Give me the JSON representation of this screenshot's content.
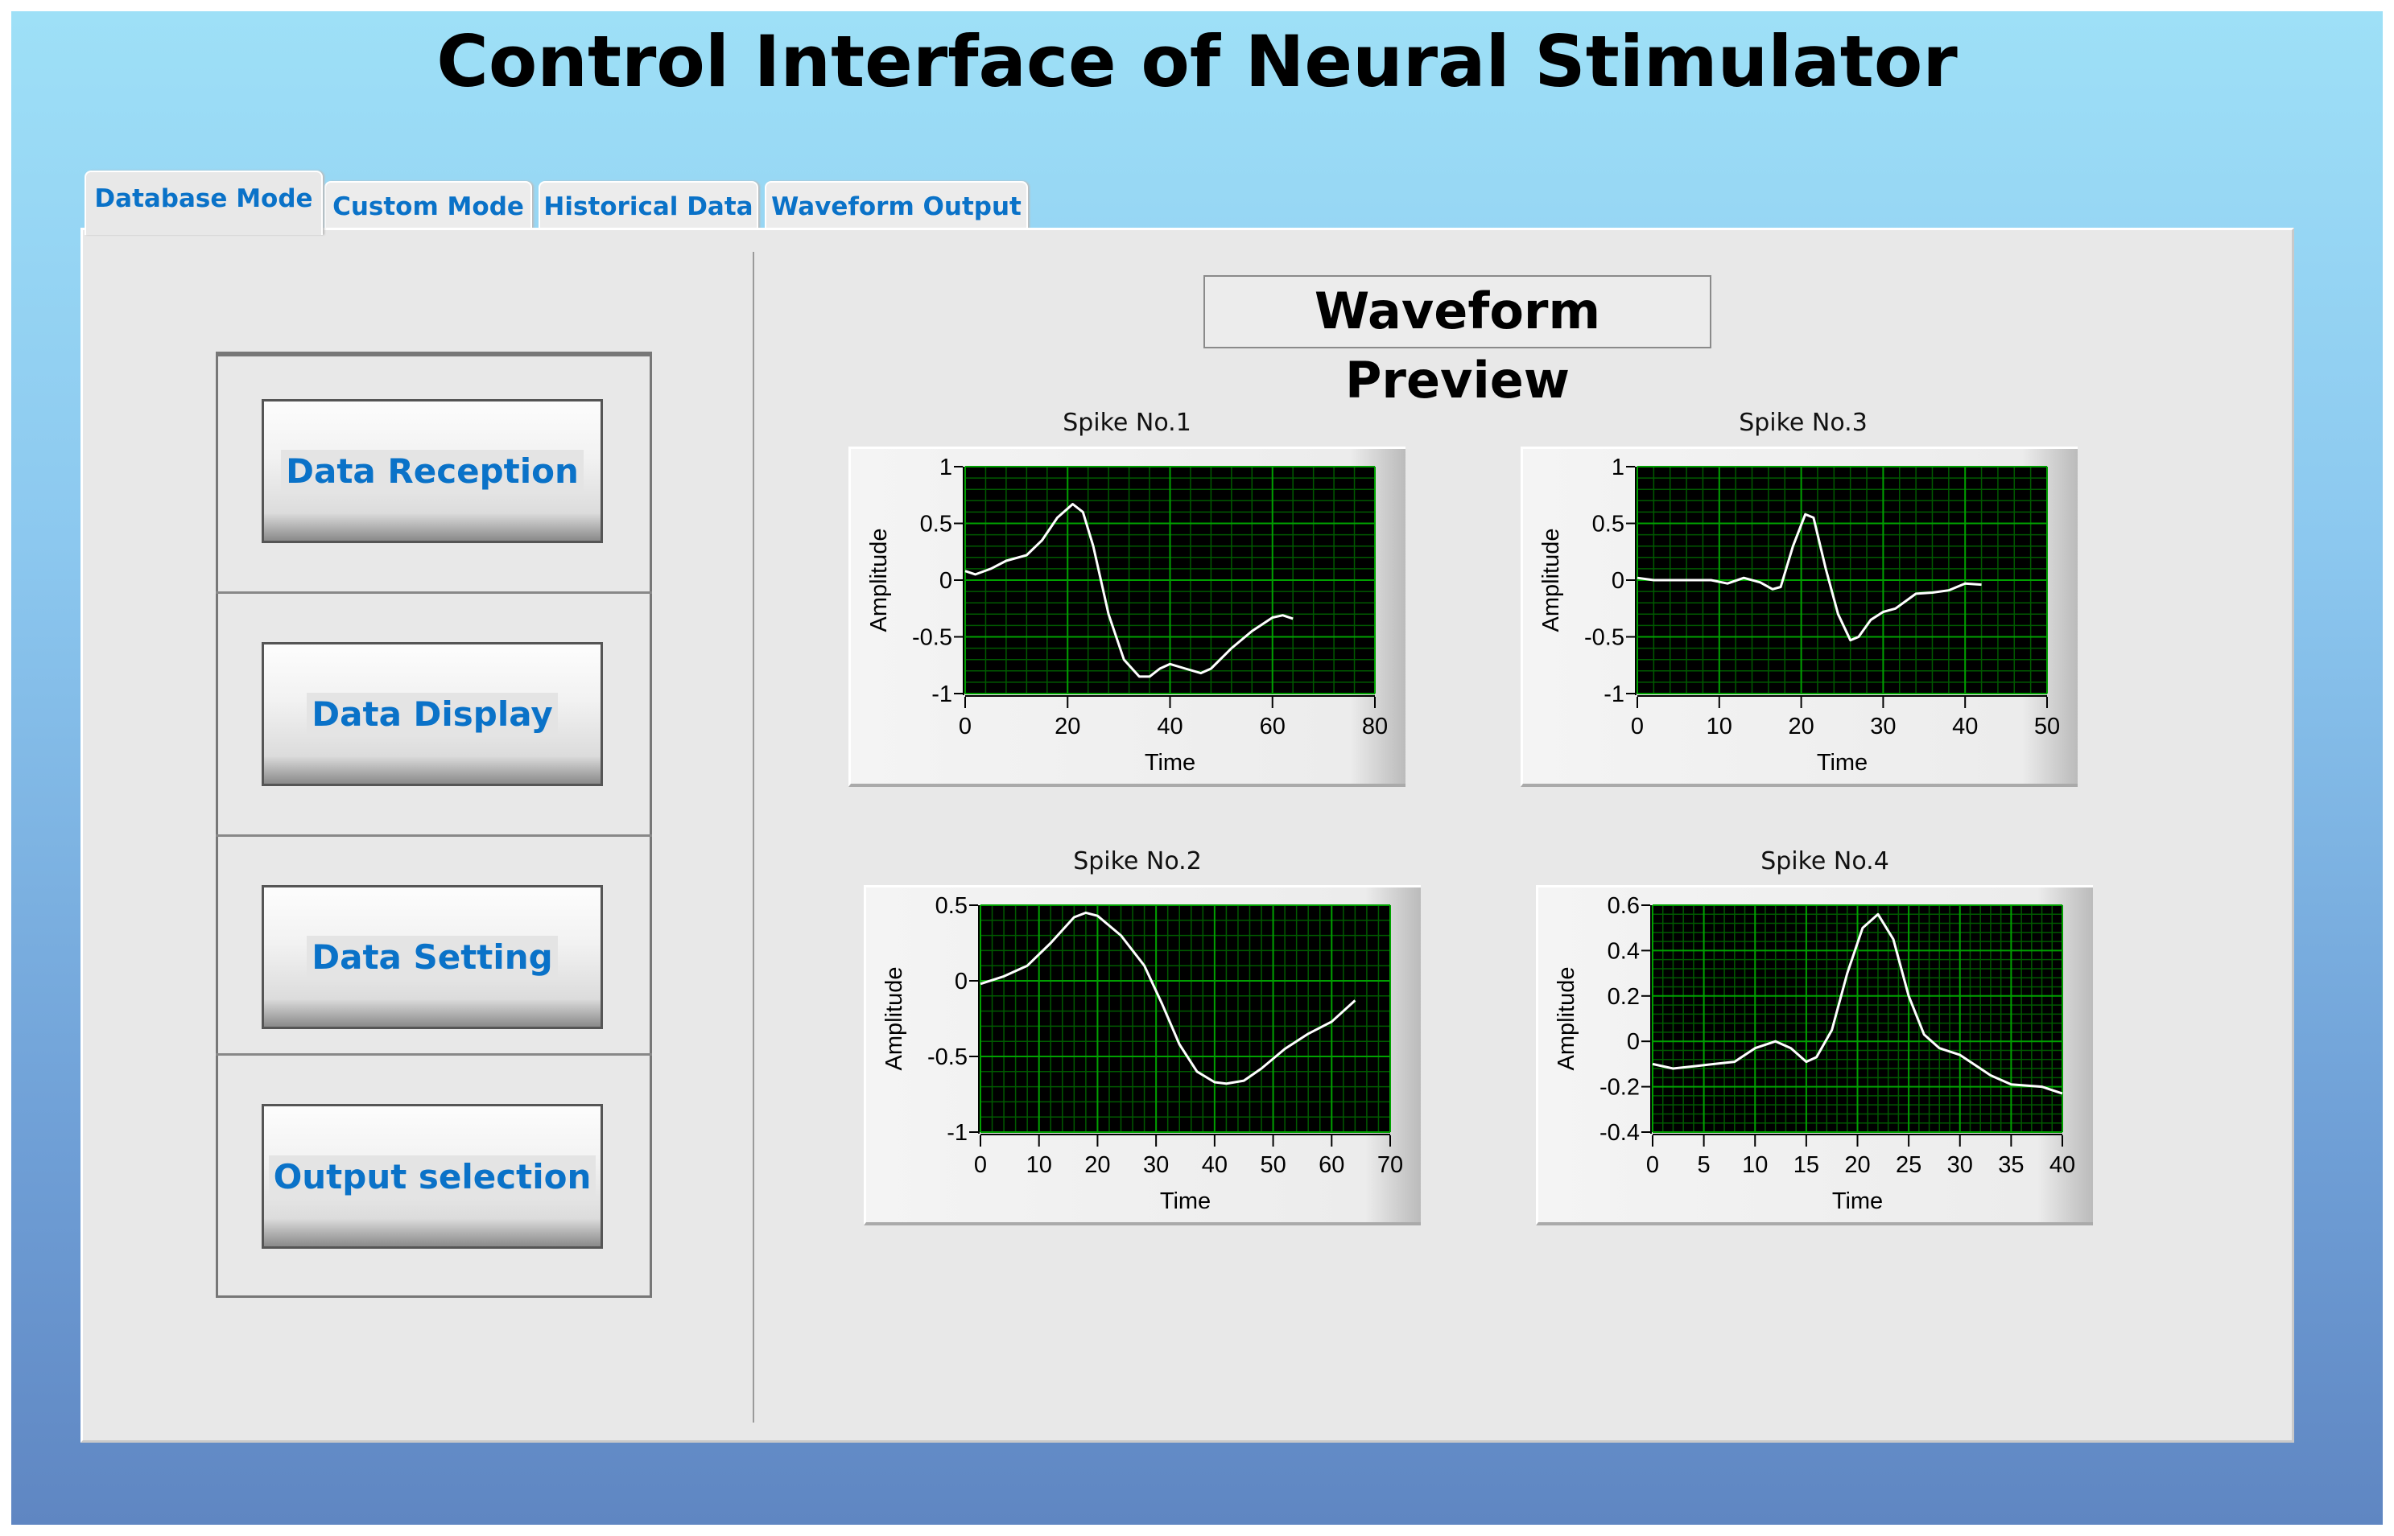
{
  "title": "Control Interface of Neural Stimulator",
  "tabs": [
    {
      "label": "Database Mode",
      "active": true
    },
    {
      "label": "Custom Mode",
      "active": false
    },
    {
      "label": "Historical Data",
      "active": false
    },
    {
      "label": "Waveform Output",
      "active": false
    }
  ],
  "buttons": [
    "Data Reception",
    "Data Display",
    "Data Setting",
    "Output selection"
  ],
  "preview_title": "Waveform Preview",
  "colors": {
    "accent": "#0a72c8",
    "plot_bg": "#000000",
    "grid_major": "#00a000",
    "grid_minor": "#005a00",
    "trace": "#ffffff"
  },
  "chart_data": [
    {
      "type": "line",
      "title": "Spike No.1",
      "xlabel": "Time",
      "ylabel": "Amplitude",
      "xlim": [
        0,
        80
      ],
      "ylim": [
        -1,
        1
      ],
      "grid": true,
      "xticks": [
        0,
        20,
        40,
        60,
        80
      ],
      "yticks": [
        -1,
        -0.5,
        0,
        0.5,
        1
      ],
      "x": [
        0,
        2,
        5,
        8,
        12,
        15,
        18,
        21,
        23,
        25,
        28,
        31,
        34,
        36,
        38,
        40,
        43,
        46,
        48,
        52,
        56,
        60,
        62,
        64
      ],
      "y": [
        0.08,
        0.05,
        0.1,
        0.17,
        0.22,
        0.35,
        0.55,
        0.67,
        0.6,
        0.3,
        -0.3,
        -0.7,
        -0.85,
        -0.85,
        -0.78,
        -0.74,
        -0.78,
        -0.82,
        -0.78,
        -0.6,
        -0.45,
        -0.33,
        -0.31,
        -0.34
      ]
    },
    {
      "type": "line",
      "title": "Spike No.3",
      "xlabel": "Time",
      "ylabel": "Amplitude",
      "xlim": [
        0,
        50
      ],
      "ylim": [
        -1,
        1
      ],
      "grid": true,
      "xticks": [
        0,
        10,
        20,
        30,
        40,
        50
      ],
      "yticks": [
        -1,
        -0.5,
        0,
        0.5,
        1
      ],
      "x": [
        0,
        2,
        9,
        11,
        13,
        15,
        16.5,
        17.5,
        19,
        20.5,
        21.5,
        23,
        24.5,
        26,
        27,
        28.5,
        30,
        31.5,
        34,
        36,
        38,
        40,
        42
      ],
      "y": [
        0.02,
        0,
        0,
        -0.03,
        0.02,
        -0.02,
        -0.08,
        -0.06,
        0.3,
        0.58,
        0.55,
        0.1,
        -0.3,
        -0.53,
        -0.5,
        -0.35,
        -0.28,
        -0.25,
        -0.12,
        -0.11,
        -0.09,
        -0.03,
        -0.04
      ]
    },
    {
      "type": "line",
      "title": "Spike No.2",
      "xlabel": "Time",
      "ylabel": "Amplitude",
      "xlim": [
        0,
        70
      ],
      "ylim": [
        -1,
        0.5
      ],
      "grid": true,
      "xticks": [
        0,
        10,
        20,
        30,
        40,
        50,
        60,
        70
      ],
      "yticks": [
        -1,
        -0.5,
        0,
        0.5
      ],
      "x": [
        0,
        4,
        8,
        12,
        16,
        18,
        20,
        24,
        28,
        31,
        34,
        37,
        40,
        42,
        45,
        48,
        52,
        56,
        60,
        64
      ],
      "y": [
        -0.02,
        0.03,
        0.1,
        0.25,
        0.42,
        0.45,
        0.43,
        0.3,
        0.1,
        -0.15,
        -0.42,
        -0.6,
        -0.67,
        -0.68,
        -0.66,
        -0.58,
        -0.45,
        -0.35,
        -0.27,
        -0.13
      ]
    },
    {
      "type": "line",
      "title": "Spike No.4",
      "xlabel": "Time",
      "ylabel": "Amplitude",
      "xlim": [
        0,
        40
      ],
      "ylim": [
        -0.4,
        0.6
      ],
      "grid": true,
      "xticks": [
        0,
        5,
        10,
        15,
        20,
        25,
        30,
        35,
        40
      ],
      "yticks": [
        -0.4,
        -0.2,
        0,
        0.2,
        0.4,
        0.6
      ],
      "x": [
        0,
        2,
        4,
        6,
        8,
        10,
        12,
        13.5,
        15,
        16,
        17.5,
        19,
        20.5,
        22,
        23.5,
        25,
        26.5,
        28,
        30,
        33,
        35,
        38,
        40
      ],
      "y": [
        -0.1,
        -0.12,
        -0.11,
        -0.1,
        -0.09,
        -0.03,
        0,
        -0.03,
        -0.09,
        -0.07,
        0.05,
        0.3,
        0.5,
        0.56,
        0.45,
        0.2,
        0.03,
        -0.03,
        -0.06,
        -0.15,
        -0.19,
        -0.2,
        -0.23
      ]
    }
  ]
}
